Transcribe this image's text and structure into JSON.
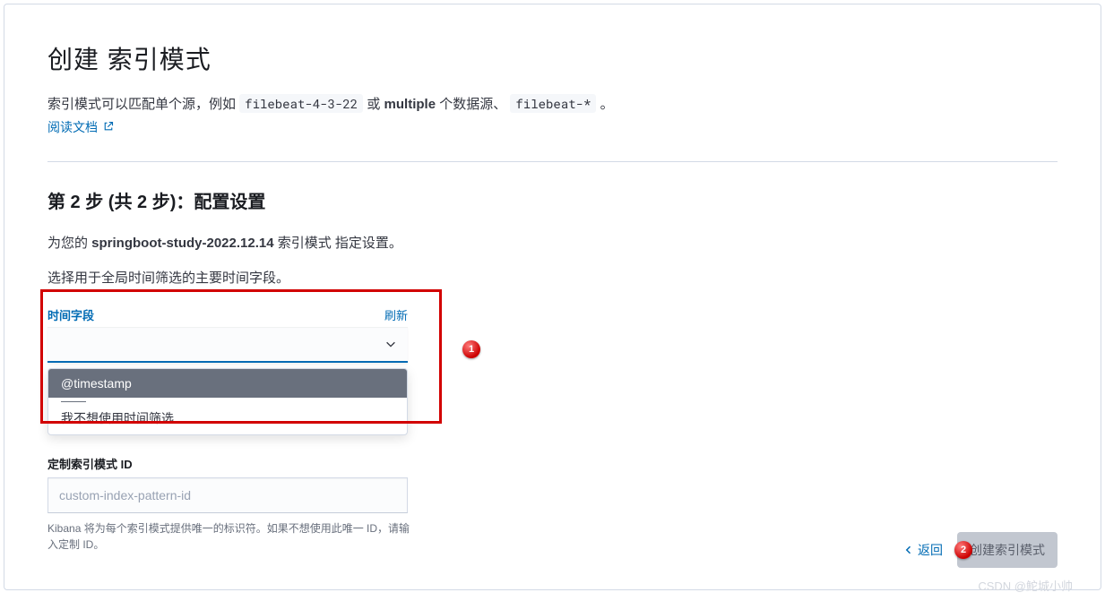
{
  "header": {
    "title": "创建 索引模式",
    "desc_prefix": "索引模式可以匹配单个源，例如 ",
    "code_example_1": "filebeat-4-3-22",
    "desc_mid": " 或 ",
    "multiple_word": "multiple",
    "desc_suffix": " 个数据源、 ",
    "code_example_2": "filebeat-*",
    "desc_end": " 。",
    "docs_link": "阅读文档"
  },
  "step": {
    "title": "第 2 步 (共 2 步)：配置设置",
    "desc_prefix": "为您的 ",
    "pattern_name": "springboot-study-2022.12.14",
    "desc_suffix": " 索引模式 指定设置。",
    "note": "选择用于全局时间筛选的主要时间字段。"
  },
  "time_field": {
    "label": "时间字段",
    "refresh": "刷新",
    "options": {
      "timestamp": "@timestamp",
      "none": "我不想使用时间筛选"
    }
  },
  "custom_id": {
    "label": "定制索引模式 ID",
    "placeholder": "custom-index-pattern-id",
    "help": "Kibana 将为每个索引模式提供唯一的标识符。如果不想使用此唯一 ID，请输入定制 ID。"
  },
  "footer": {
    "back": "返回",
    "create": "创建索引模式"
  },
  "annotations": {
    "one": "1",
    "two": "2"
  },
  "watermark": "CSDN @鮀城小帅"
}
